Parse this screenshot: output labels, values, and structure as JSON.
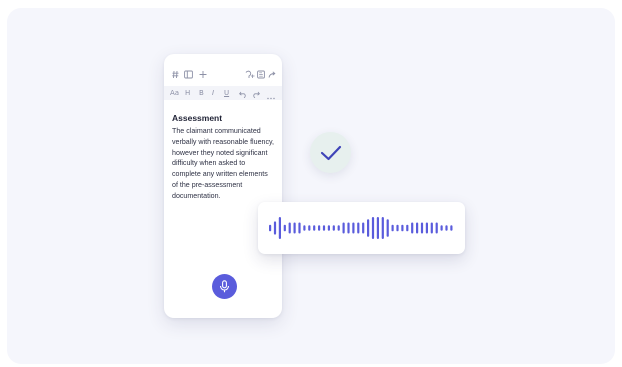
{
  "toolbar_top": {
    "left_icons": [
      "hash-icon",
      "sidebar-icon",
      "plus-icon"
    ],
    "right_icons": [
      "dictate-icon",
      "export-icon",
      "share-icon"
    ]
  },
  "toolbar_format": {
    "items": [
      "Aa",
      "H",
      "B",
      "I",
      "U"
    ],
    "extra_icons": [
      "undo-icon",
      "redo-icon",
      "more-icon"
    ]
  },
  "document": {
    "heading": "Assessment",
    "lines": [
      "The claimant communicated",
      "verbally with reasonable fluency,",
      "however they noted significant",
      "difficulty when asked to",
      "complete any written elements",
      "of the pre-assessment",
      "documentation."
    ]
  },
  "mic_button": {
    "icon": "microphone-icon"
  },
  "status": {
    "icon": "checkmark-icon"
  },
  "waveform": {
    "icon": "audio-waveform",
    "color": "#5a5cdc",
    "levels": [
      0.3,
      0.6,
      1.0,
      0.3,
      0.5,
      0.5,
      0.5,
      0.25,
      0.25,
      0.25,
      0.25,
      0.25,
      0.25,
      0.25,
      0.25,
      0.5,
      0.5,
      0.5,
      0.5,
      0.5,
      0.8,
      1.0,
      1.0,
      1.0,
      0.8,
      0.3,
      0.3,
      0.3,
      0.3,
      0.5,
      0.5,
      0.5,
      0.5,
      0.5,
      0.5,
      0.25,
      0.25,
      0.25
    ]
  },
  "colors": {
    "accent": "#5a5cdc",
    "check_bg": "#e7f0ee",
    "stage_bg": "#f5f6fc"
  }
}
